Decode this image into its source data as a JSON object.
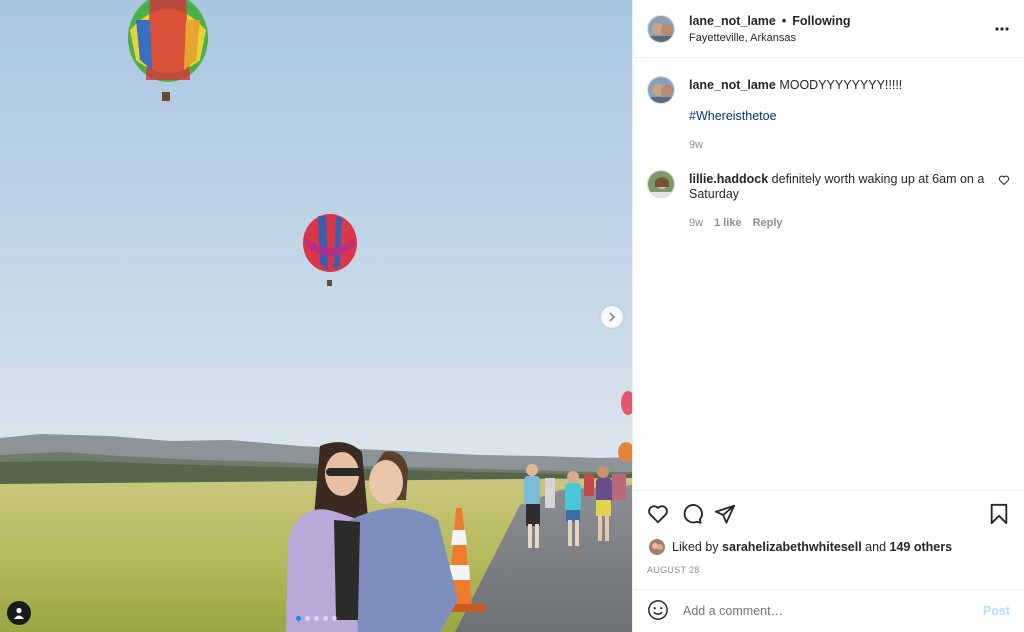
{
  "post": {
    "username": "lane_not_lame",
    "follow_status": "Following",
    "separator": "•",
    "location": "Fayetteville, Arkansas",
    "carousel_dots": 5,
    "active_dot": 0
  },
  "caption": {
    "username": "lane_not_lame",
    "text": "MOODYYYYYYYY!!!!!",
    "hashtag": "#Whereisthetoe",
    "time": "9w"
  },
  "comments": [
    {
      "username": "lillie.haddock",
      "text": "definitely worth waking up at 6am on a Saturday",
      "time": "9w",
      "likes": "1 like",
      "reply": "Reply"
    }
  ],
  "likes": {
    "prefix": "Liked by",
    "user": "sarahelizabethwhitesell",
    "and": "and",
    "others": "149 others"
  },
  "date": "AUGUST 28",
  "composer": {
    "placeholder": "Add a comment…",
    "post_label": "Post"
  },
  "colors": {
    "link": "#00376b",
    "muted": "#8e8e8e",
    "post_disabled": "#b2dffc",
    "dot_active": "#0095f6"
  },
  "icons": {
    "more": "more-horizontal-icon",
    "like": "heart-icon",
    "comment": "comment-bubble-icon",
    "share": "paper-plane-icon",
    "save": "bookmark-icon",
    "emoji": "emoji-icon",
    "next": "chevron-right-icon",
    "tag": "user-tag-icon"
  }
}
